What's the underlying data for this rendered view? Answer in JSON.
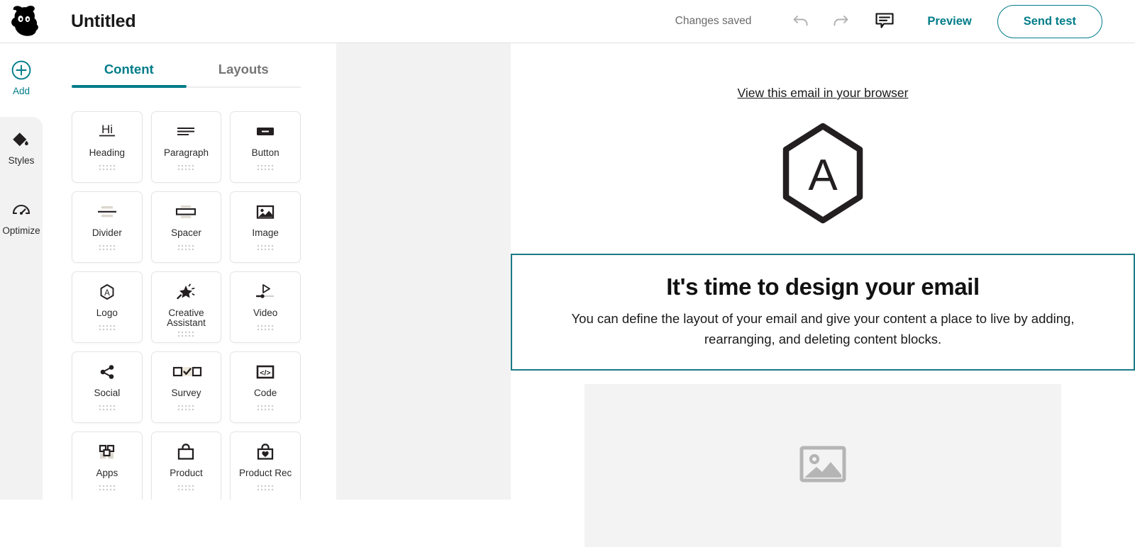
{
  "topbar": {
    "logo_icon": "mailchimp-monkey-logo",
    "title": "Untitled",
    "saved_status": "Changes saved",
    "undo_icon": "undo-arrow-icon",
    "redo_icon": "redo-arrow-icon",
    "comment_icon": "comment-bubble-icon",
    "preview_label": "Preview",
    "send_test_label": "Send test",
    "accent_color": "#007c89"
  },
  "rail": {
    "items": [
      {
        "label": "Add",
        "icon": "plus-circle-icon",
        "active": true
      },
      {
        "label": "Styles",
        "icon": "ink-drop-icon",
        "active": false
      },
      {
        "label": "Optimize",
        "icon": "gauge-icon",
        "active": false
      }
    ]
  },
  "panel": {
    "tabs": [
      {
        "label": "Content",
        "active": true
      },
      {
        "label": "Layouts",
        "active": false
      }
    ],
    "blocks": [
      {
        "label": "Heading",
        "icon": "heading-hi-icon"
      },
      {
        "label": "Paragraph",
        "icon": "paragraph-lines-icon"
      },
      {
        "label": "Button",
        "icon": "button-pill-icon"
      },
      {
        "label": "Divider",
        "icon": "divider-line-icon"
      },
      {
        "label": "Spacer",
        "icon": "spacer-box-icon"
      },
      {
        "label": "Image",
        "icon": "image-picture-icon"
      },
      {
        "label": "Logo",
        "icon": "logo-hexagon-a-icon"
      },
      {
        "label": "Creative Assistant",
        "icon": "magic-wand-sparkle-icon"
      },
      {
        "label": "Video",
        "icon": "video-play-scrubber-icon"
      },
      {
        "label": "Social",
        "icon": "social-share-icon"
      },
      {
        "label": "Survey",
        "icon": "survey-checkbox-icon"
      },
      {
        "label": "Code",
        "icon": "code-brackets-icon"
      },
      {
        "label": "Apps",
        "icon": "apps-grid-icon"
      },
      {
        "label": "Product",
        "icon": "product-bag-icon"
      },
      {
        "label": "Product Rec",
        "icon": "product-rec-bag-heart-icon"
      }
    ],
    "drag_handle_icon": "drag-dots-icon"
  },
  "canvas": {
    "preheader_link": "View this email in your browser",
    "logo_placeholder_letter": "A",
    "logo_placeholder_icon": "hexagon-logo-placeholder",
    "selected_block": {
      "heading": "It's time to design your email",
      "body": "You can define the layout of your email and give your content a place to live by adding, rearranging, and deleting content blocks.",
      "selection_color": "#1b7b86"
    },
    "image_placeholder_icon": "image-placeholder-icon"
  }
}
